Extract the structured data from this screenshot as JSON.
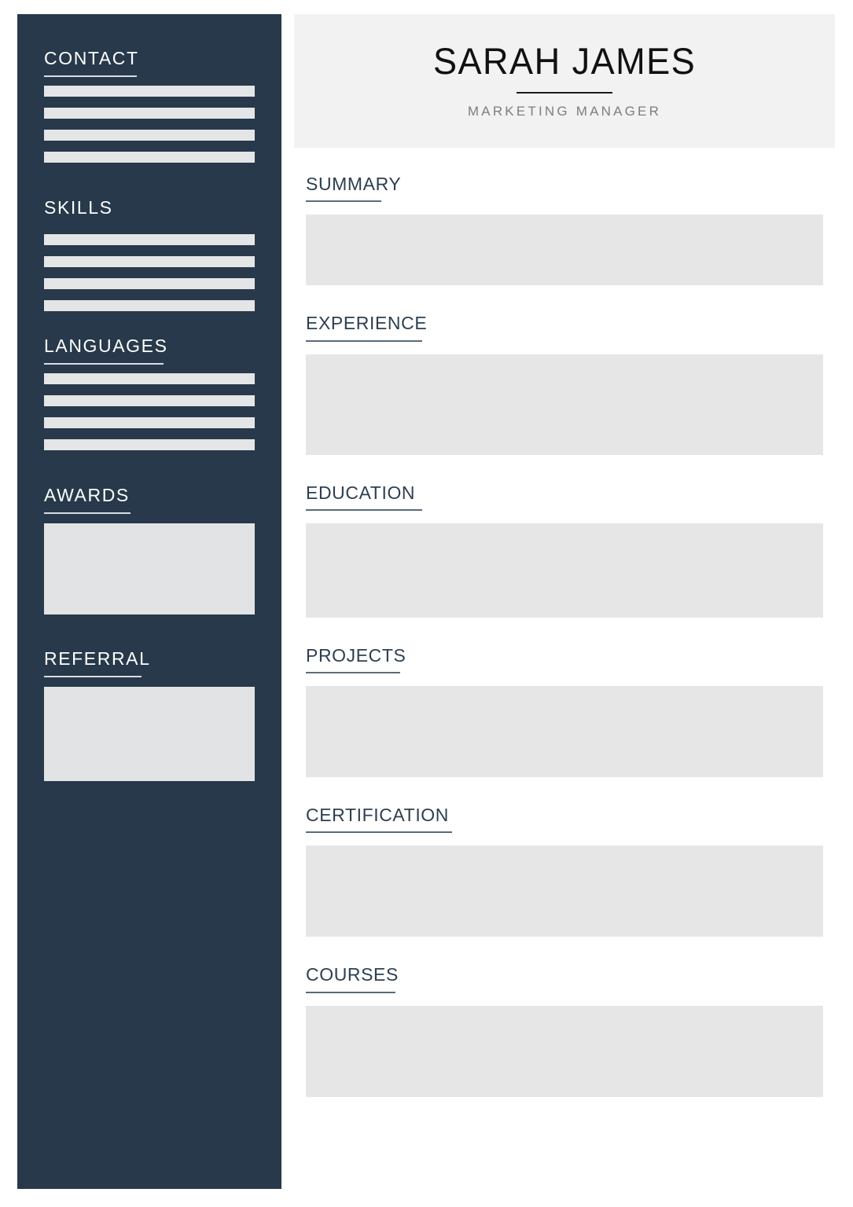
{
  "document": {
    "type": "resume-template",
    "colors": {
      "sidebar_bg": "#27394a",
      "header_bg": "#f2f2f2",
      "placeholder": "#e6e6e6",
      "sidebar_placeholder": "#e4e5e6",
      "heading_navy": "#2d3f50",
      "name_black": "#111111",
      "subtitle_gray": "#7d7d7d",
      "page_bg": "#ffffff"
    }
  },
  "header": {
    "name": "SARAH JAMES",
    "job_title": "MARKETING MANAGER"
  },
  "sidebar": {
    "sections": [
      {
        "id": "contact",
        "heading": "CONTACT",
        "placeholder_type": "bars",
        "bar_count": 4,
        "has_rule": true
      },
      {
        "id": "skills",
        "heading": "SKILLS",
        "placeholder_type": "bars",
        "bar_count": 4,
        "has_rule": false
      },
      {
        "id": "languages",
        "heading": "LANGUAGES",
        "placeholder_type": "bars",
        "bar_count": 4,
        "has_rule": true
      },
      {
        "id": "awards",
        "heading": "AWARDS",
        "placeholder_type": "block",
        "bar_count": 0,
        "has_rule": true
      },
      {
        "id": "referral",
        "heading": "REFERRAL",
        "placeholder_type": "block",
        "bar_count": 0,
        "has_rule": true
      }
    ]
  },
  "main": {
    "sections": [
      {
        "id": "summary",
        "heading": "SUMMARY"
      },
      {
        "id": "experience",
        "heading": "EXPERIENCE"
      },
      {
        "id": "education",
        "heading": "EDUCATION"
      },
      {
        "id": "projects",
        "heading": "PROJECTS"
      },
      {
        "id": "certification",
        "heading": "CERTIFICATION"
      },
      {
        "id": "courses",
        "heading": "COURSES"
      }
    ]
  }
}
